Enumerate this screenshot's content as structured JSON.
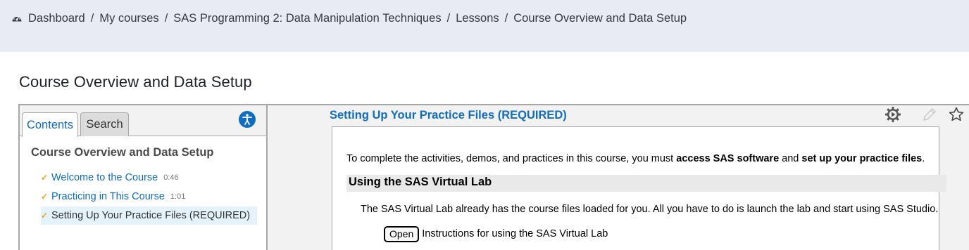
{
  "breadcrumb": {
    "icon": "dashboard-icon",
    "items": [
      "Dashboard",
      "My courses",
      "SAS Programming 2: Data Manipulation Techniques",
      "Lessons",
      "Course Overview and Data Setup"
    ],
    "separator": "/"
  },
  "page": {
    "title": "Course Overview and Data Setup"
  },
  "tabs": {
    "contents": "Contents",
    "search": "Search",
    "active": "Contents"
  },
  "toc": {
    "title": "Course Overview and Data Setup",
    "items": [
      {
        "label": "Welcome to the Course",
        "duration": "0:46",
        "completed": true,
        "active": false
      },
      {
        "label": "Practicing in This Course",
        "duration": "1:01",
        "completed": true,
        "active": false
      },
      {
        "label": "Setting Up Your Practice Files (REQUIRED)",
        "duration": "",
        "completed": true,
        "active": true
      }
    ],
    "check_color": "#f0a21b"
  },
  "content": {
    "heading": "Setting Up Your Practice Files (REQUIRED)",
    "intro_1": "To complete the activities, demos, and practices in this course, you must ",
    "intro_b1": "access SAS software",
    "intro_2": " and ",
    "intro_b2": "set up your practice files",
    "intro_3": ".",
    "section_title": "Using the SAS Virtual Lab",
    "lab_description": "The SAS Virtual Lab already has the course files loaded for you. All you have to do is launch the lab and start using SAS Studio.",
    "open_button": "Open",
    "open_text": "Instructions for using the SAS Virtual Lab"
  },
  "toolbar": {
    "icons": [
      "settings-gear-icon",
      "edit-pencil-icon",
      "favorite-star-icon"
    ]
  },
  "colors": {
    "link": "#0f6cbf",
    "topbar": "#e8ebf3",
    "accessibility": "#0f6cbf"
  }
}
